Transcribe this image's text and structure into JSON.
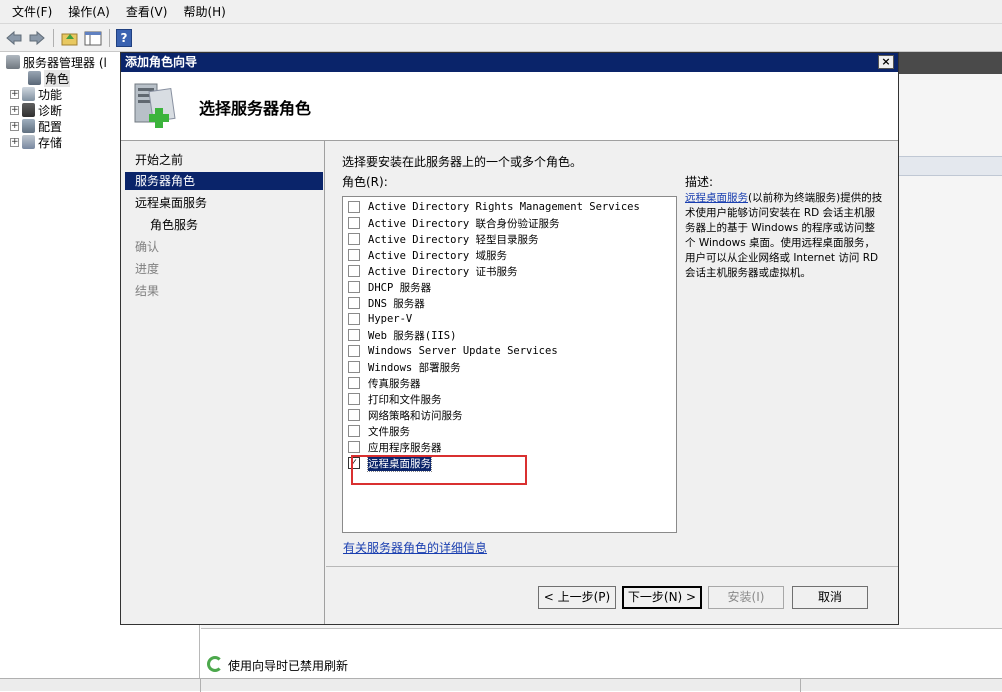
{
  "menubar": {
    "items": [
      "文件(F)",
      "操作(A)",
      "查看(V)",
      "帮助(H)"
    ]
  },
  "toolbar": {
    "help_label": "?"
  },
  "tree": {
    "root": "服务器管理器 (l",
    "items": [
      "角色",
      "功能",
      "诊断",
      "配置",
      "存储"
    ],
    "expander_symbol": "+"
  },
  "status": {
    "text": "使用向导时已禁用刷新"
  },
  "dialog": {
    "title": "添加角色向导",
    "close_symbol": "×",
    "header_title": "选择服务器角色",
    "nav": [
      "开始之前",
      "服务器角色",
      "远程桌面服务",
      "角色服务",
      "确认",
      "进度",
      "结果"
    ],
    "instruction": "选择要安装在此服务器上的一个或多个角色。",
    "roles_label": "角色(R):",
    "roles": [
      "Active Directory Rights Management Services",
      "Active Directory 联合身份验证服务",
      "Active Directory 轻型目录服务",
      "Active Directory 域服务",
      "Active Directory 证书服务",
      "DHCP 服务器",
      "DNS 服务器",
      "Hyper-V",
      "Web 服务器(IIS)",
      "Windows Server Update Services",
      "Windows 部署服务",
      "传真服务器",
      "打印和文件服务",
      "网络策略和访问服务",
      "文件服务",
      "应用程序服务器",
      "远程桌面服务"
    ],
    "checked_mark": "✓",
    "more_link": "有关服务器角色的详细信息",
    "description_label": "描述:",
    "description_link": "远程桌面服务",
    "description_text": "(以前称为终端服务)提供的技术使用户能够访问安装在 RD 会话主机服务器上的基于 Windows 的程序或访问整个 Windows 桌面。使用远程桌面服务，用户可以从企业网络或 Internet 访问 RD 会话主机服务器或虚拟机。",
    "buttons": {
      "back": "< 上一步(P)",
      "next": "下一步(N) >",
      "install": "安装(I)",
      "cancel": "取消"
    }
  }
}
